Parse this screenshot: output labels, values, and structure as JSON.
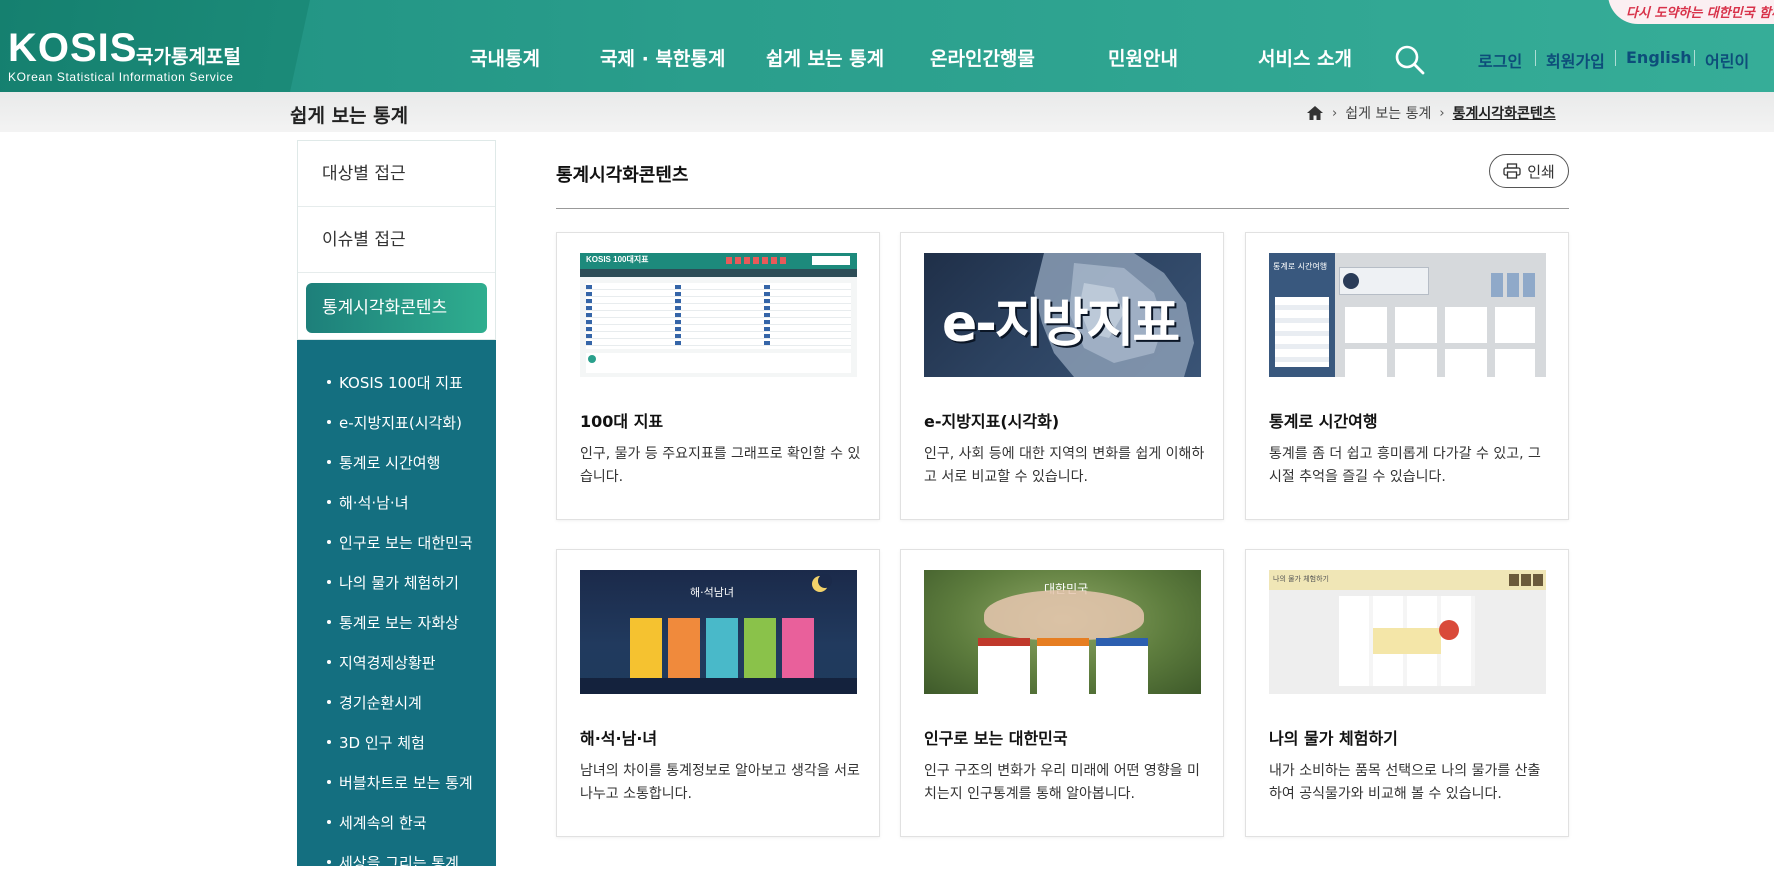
{
  "header": {
    "logo_main": "KOSIS",
    "logo_kr": "국가통계포털",
    "logo_sub": "KOrean Statistical Information Service",
    "nav": [
      "국내통계",
      "국제 · 북한통계",
      "쉽게 보는 통계",
      "온라인간행물",
      "민원안내",
      "서비스 소개"
    ],
    "util": [
      "로그인",
      "회원가입",
      "English",
      "어린이"
    ],
    "promo": "다시 도약하는 대한민국 함께 ..."
  },
  "page": {
    "title": "쉽게 보는 통계",
    "breadcrumb": [
      "쉽게 보는 통계",
      "통계시각화콘텐츠"
    ]
  },
  "sidebar": {
    "top_items": [
      "대상별 접근",
      "이슈별 접근"
    ],
    "active": "통계시각화콘텐츠",
    "sub_items": [
      "KOSIS 100대 지표",
      "e-지방지표(시각화)",
      "통계로 시간여행",
      "해·석·남·녀",
      "인구로 보는 대한민국",
      "나의 물가 체험하기",
      "통계로 보는 자화상",
      "지역경제상황판",
      "경기순환시계",
      "3D 인구 체험",
      "버블차트로 보는 통계",
      "세계속의 한국",
      "세상을 그리는 통계"
    ]
  },
  "main": {
    "title": "통계시각화콘텐츠",
    "print_label": "인쇄",
    "cards": [
      {
        "title": "100대 지표",
        "desc": "인구, 물가 등 주요지표를 그래프로 확인할 수 있습니다.",
        "thumb_text": "KOSIS 100대지표"
      },
      {
        "title": "e-지방지표(시각화)",
        "desc": "인구, 사회 등에 대한 지역의 변화를 쉽게 이해하고 서로 비교할 수 있습니다.",
        "thumb_text": "e-지방지표"
      },
      {
        "title": "통계로 시간여행",
        "desc": "통계를 좀 더 쉽고 흥미롭게 다가갈 수 있고, 그 시절 추억을 즐길 수 있습니다.",
        "thumb_text": "통계로 시간여행"
      },
      {
        "title": "해·석·남·녀",
        "desc": "남녀의 차이를 통계정보로 알아보고 생각을 서로 나누고 소통합니다.",
        "thumb_text": "해·석남녀"
      },
      {
        "title": "인구로 보는 대한민국",
        "desc": "인구 구조의 변화가 우리 미래에 어떤 영향을 미치는지 인구통계를 통해 알아봅니다.",
        "thumb_text": "대한민국"
      },
      {
        "title": "나의 물가 체험하기",
        "desc": "내가 소비하는 품목 선택으로 나의 물가를 산출하여 공식물가와 비교해 볼 수 있습니다.",
        "thumb_text": "나의 물가 체험하기"
      }
    ]
  },
  "colors": {
    "header_green": "#2a9e8c",
    "sidebar_teal": "#146f80",
    "util_blue": "#0d4d7a"
  }
}
